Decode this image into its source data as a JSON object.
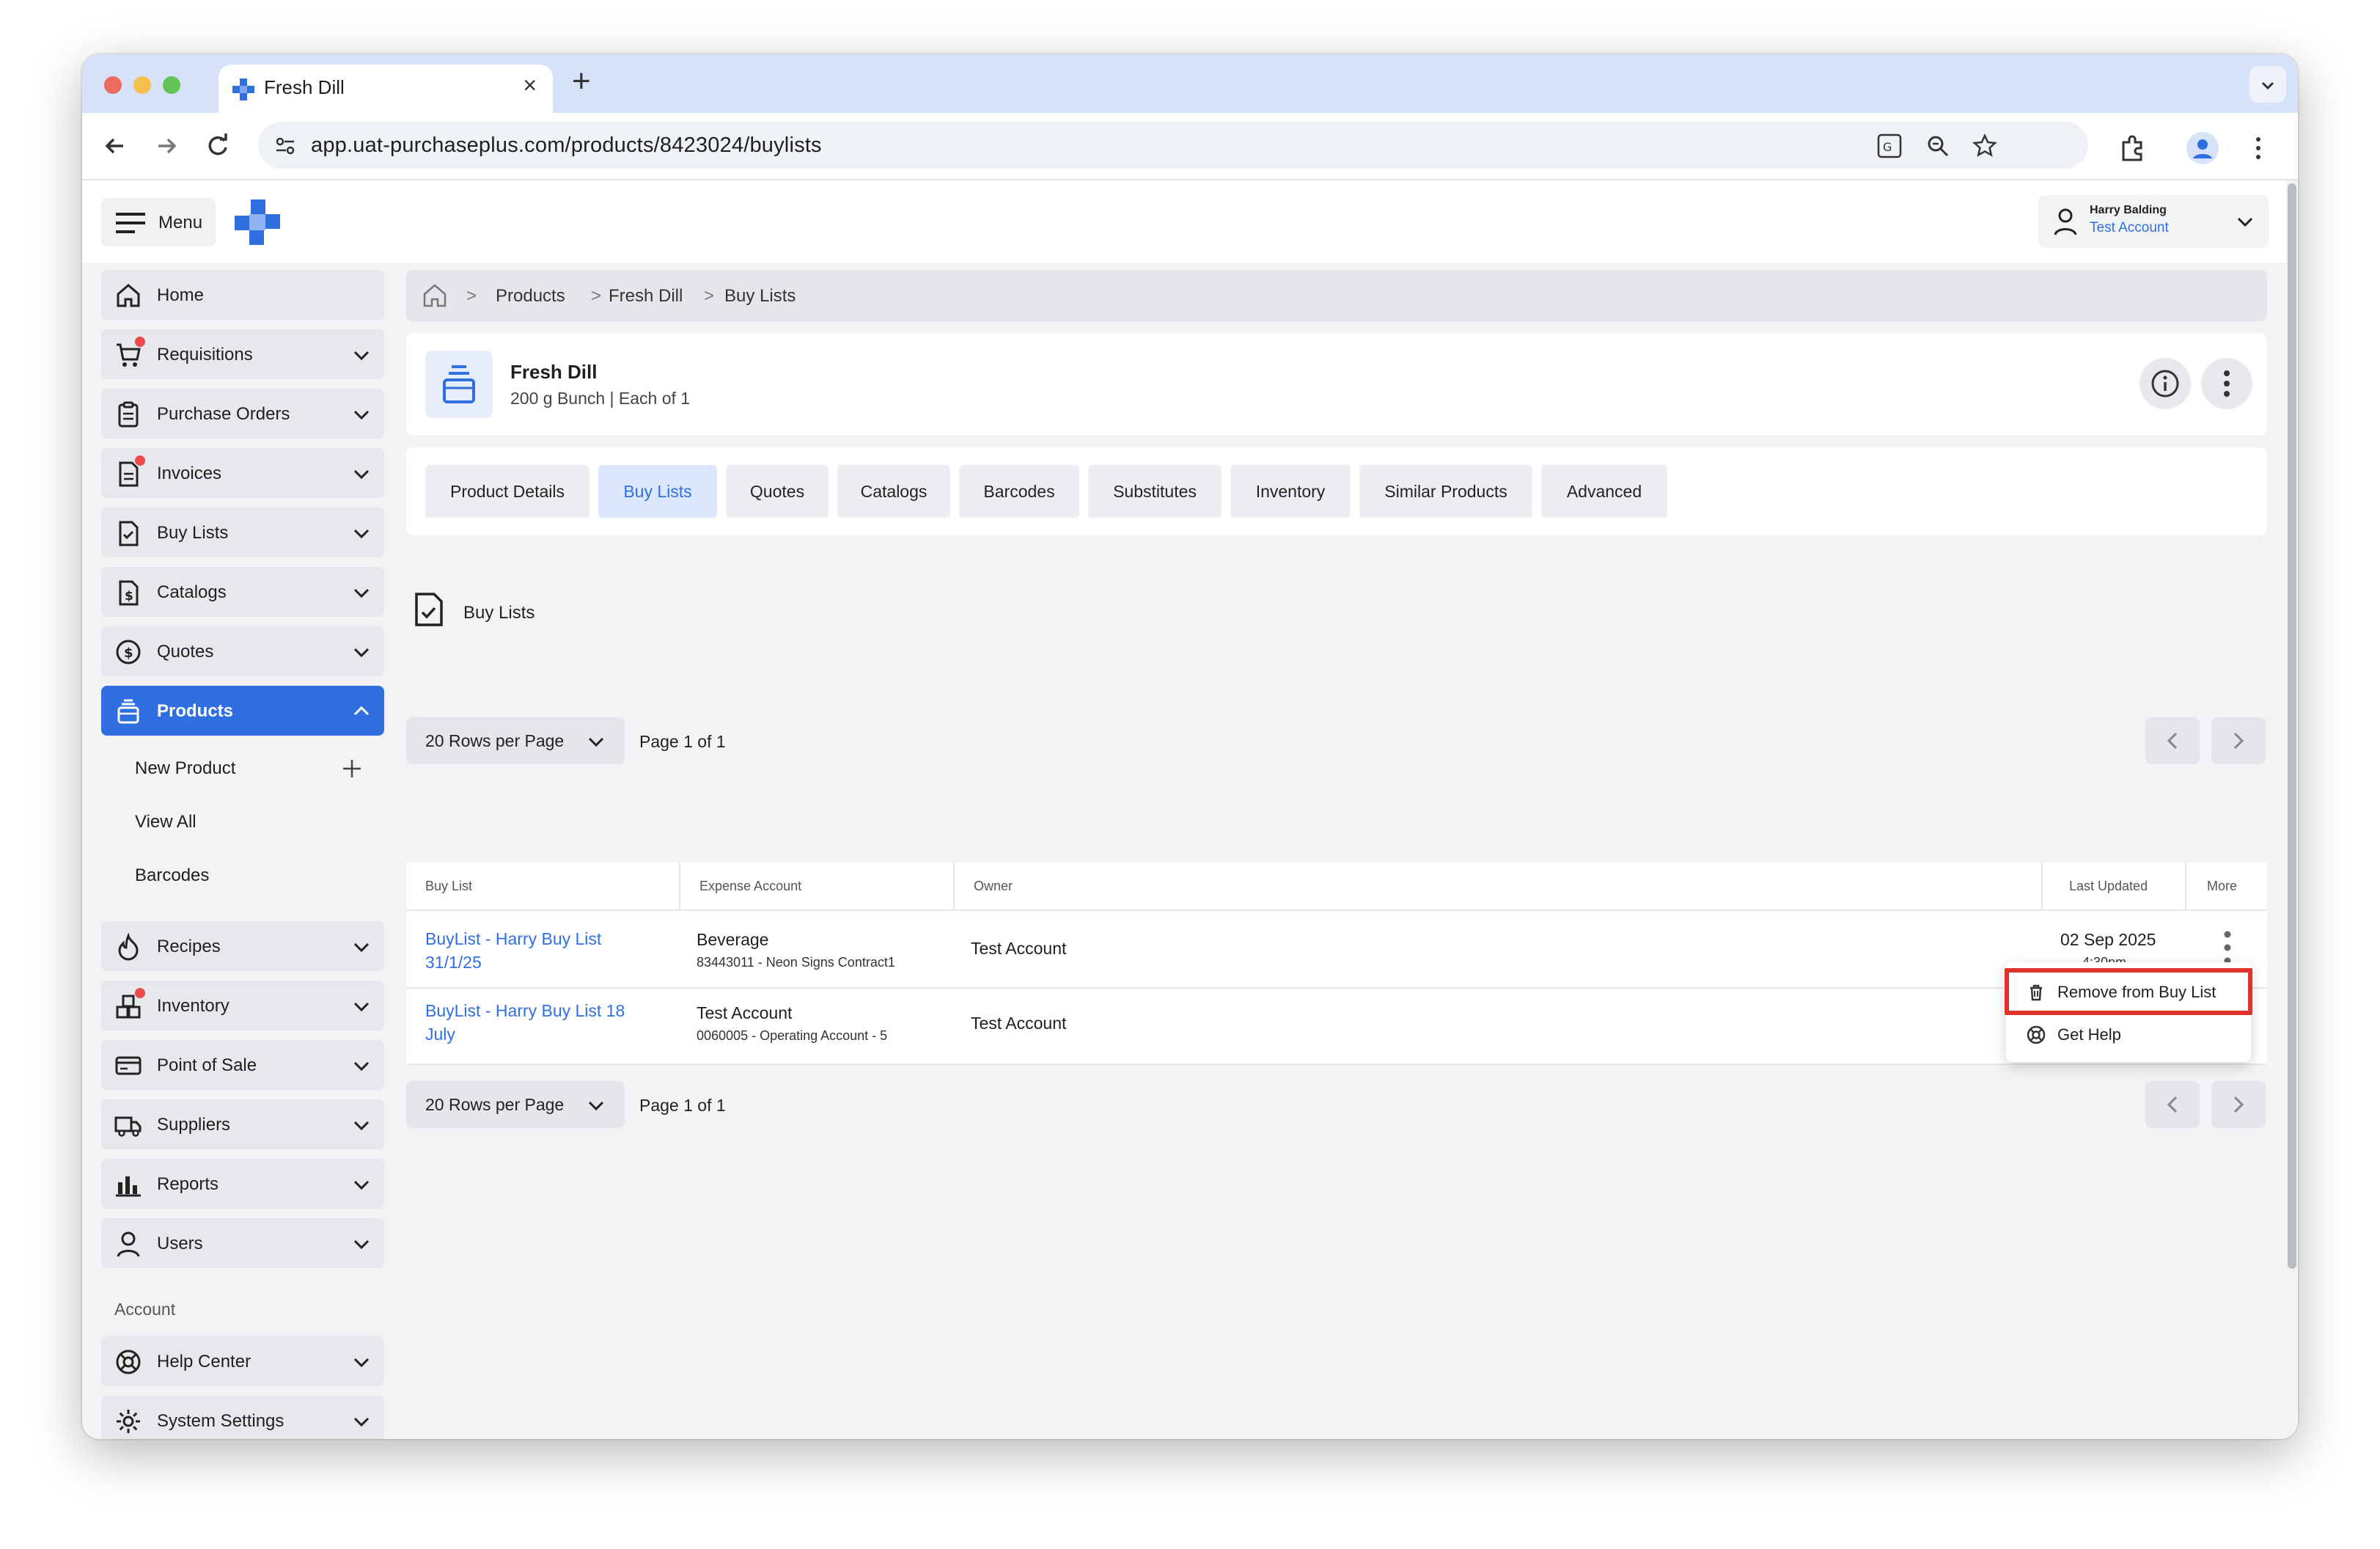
{
  "browser": {
    "tab_title": "Fresh Dill",
    "url": "app.uat-purchaseplus.com/products/8423024/buylists"
  },
  "header": {
    "menu_label": "Menu",
    "user_name": "Harry Balding",
    "user_account": "Test Account"
  },
  "sidebar": {
    "items": [
      {
        "label": "Home",
        "icon": "home-icon"
      },
      {
        "label": "Requisitions",
        "icon": "cart-icon"
      },
      {
        "label": "Purchase Orders",
        "icon": "clipboard-icon"
      },
      {
        "label": "Invoices",
        "icon": "invoice-icon"
      },
      {
        "label": "Buy Lists",
        "icon": "checklist-icon"
      },
      {
        "label": "Catalogs",
        "icon": "catalog-icon"
      },
      {
        "label": "Quotes",
        "icon": "dollar-icon"
      },
      {
        "label": "Products",
        "icon": "products-icon"
      },
      {
        "label": "Recipes",
        "icon": "flame-icon"
      },
      {
        "label": "Inventory",
        "icon": "boxes-icon"
      },
      {
        "label": "Point of Sale",
        "icon": "card-icon"
      },
      {
        "label": "Suppliers",
        "icon": "truck-icon"
      },
      {
        "label": "Reports",
        "icon": "chart-icon"
      },
      {
        "label": "Users",
        "icon": "user-icon"
      }
    ],
    "products_sub": [
      "New Product",
      "View All",
      "Barcodes"
    ],
    "account_section": "Account",
    "account_items": [
      {
        "label": "Help Center",
        "icon": "lifebuoy-icon"
      },
      {
        "label": "System Settings",
        "icon": "gear-icon"
      }
    ]
  },
  "breadcrumb": [
    "Products",
    "Fresh Dill",
    "Buy Lists"
  ],
  "product": {
    "name": "Fresh Dill",
    "description": "200 g Bunch | Each of 1"
  },
  "tabs": [
    "Product Details",
    "Buy Lists",
    "Quotes",
    "Catalogs",
    "Barcodes",
    "Substitutes",
    "Inventory",
    "Similar Products",
    "Advanced"
  ],
  "active_tab": "Buy Lists",
  "section_title": "Buy Lists",
  "pagination": {
    "rows_per_page": "20 Rows per Page",
    "page_label": "Page 1 of 1"
  },
  "table": {
    "headers": [
      "Buy List",
      "Expense Account",
      "Owner",
      "Last Updated",
      "More"
    ],
    "rows": [
      {
        "buy_list_line1": "BuyList - Harry Buy List",
        "buy_list_line2": "31/1/25",
        "expense_account": "Beverage",
        "expense_sub": "83443011 - Neon Signs Contract1",
        "owner": "Test Account",
        "last_updated_date": "02 Sep 2025",
        "last_updated_time": "4:30pm"
      },
      {
        "buy_list_line1": "BuyList - Harry Buy List 18",
        "buy_list_line2": "July",
        "expense_account": "Test Account",
        "expense_sub": "0060005 - Operating Account - 5",
        "owner": "Test Account",
        "last_updated_date": "",
        "last_updated_time": ""
      }
    ]
  },
  "context_menu": {
    "items": [
      "Remove from Buy List",
      "Get Help"
    ]
  },
  "colors": {
    "accent": "#2f6fe0",
    "highlight": "#e0332a",
    "notification_dot": "#ec4b4b"
  }
}
